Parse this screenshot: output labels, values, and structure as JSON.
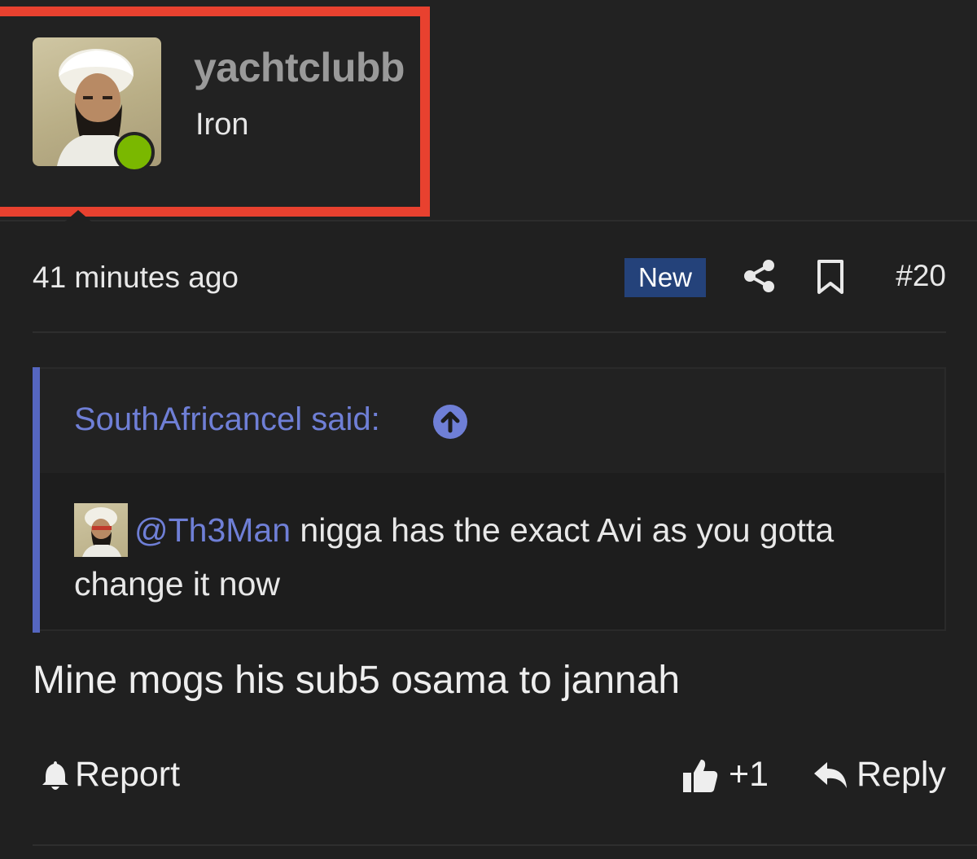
{
  "user": {
    "username": "yachtclubb",
    "title": "Iron",
    "online_status_color": "#7ab800",
    "avatar_icon": "user-avatar"
  },
  "meta": {
    "timestamp": "41 minutes ago",
    "badge": "New",
    "post_number": "#20",
    "share_icon": "share-icon",
    "bookmark_icon": "bookmark-icon"
  },
  "quote": {
    "author": "SouthAfricancel said:",
    "mention": "@Th3Man",
    "text": " nigga has the exact Avi as you gotta change it now",
    "arrow_icon": "arrow-up-circle-icon",
    "accent_color": "#6f7fd6"
  },
  "message": "Mine mogs his sub5 osama to jannah",
  "actions": {
    "report_label": "Report",
    "like_count": "+1",
    "reply_label": "Reply"
  },
  "colors": {
    "highlight_box": "#e8412f",
    "badge_bg": "#24427a",
    "quote_bar": "#5566c0"
  }
}
